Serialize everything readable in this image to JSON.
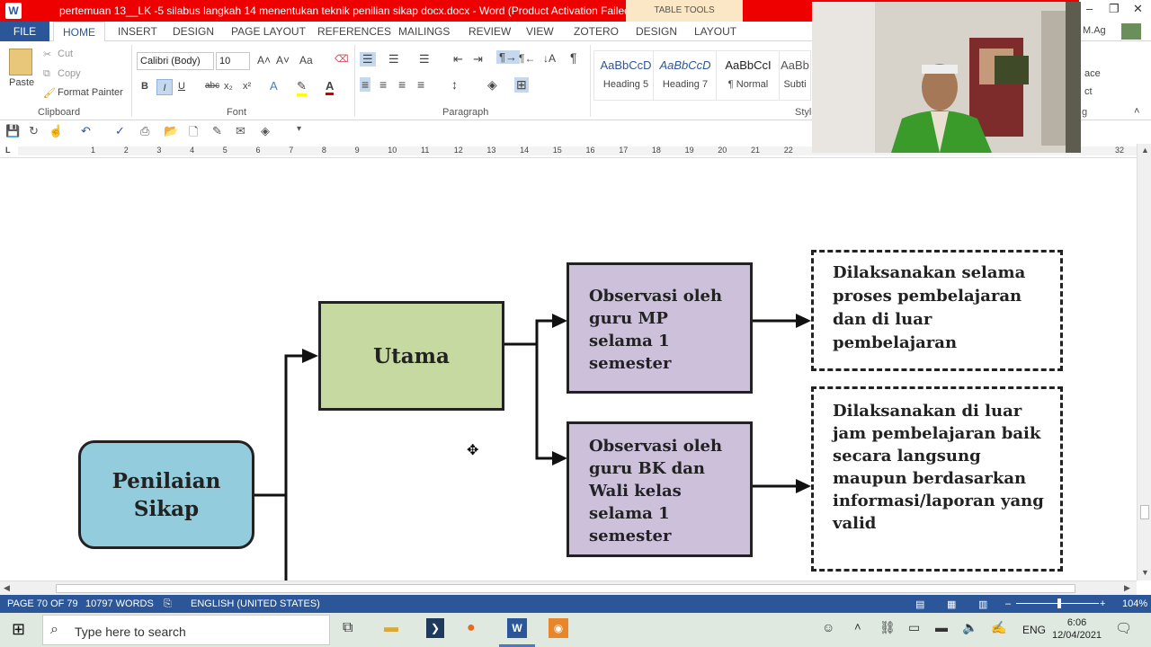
{
  "titlebar": {
    "title": "pertemuan 13__LK -5 silabus langkah 14 menentukan teknik penilian sikap docx.docx  -  Word (Product Activation Failed)",
    "table_tools": "TABLE TOOLS",
    "word_icon": "W"
  },
  "tabs": {
    "file": "FILE",
    "home": "HOME",
    "insert": "INSERT",
    "design": "DESIGN",
    "page_layout": "PAGE LAYOUT",
    "references": "REFERENCES",
    "mailings": "MAILINGS",
    "review": "REVIEW",
    "view": "VIEW",
    "zotero": "ZOTERO",
    "tt_design": "DESIGN",
    "tt_layout": "LAYOUT",
    "user": "M.Ag"
  },
  "ribbon": {
    "clipboard": {
      "paste": "Paste",
      "cut": "Cut",
      "copy": "Copy",
      "format_painter": "Format Painter",
      "label": "Clipboard"
    },
    "font": {
      "name": "Calibri (Body)",
      "size": "10",
      "label": "Font",
      "bold": "B",
      "italic": "I",
      "underline": "U",
      "strike": "abc",
      "sub": "x₂",
      "sup": "x²",
      "aa": "Aa"
    },
    "paragraph": {
      "label": "Paragraph"
    },
    "styles": {
      "label": "Styles",
      "items": [
        {
          "sample": "AaBbCcD",
          "name": "Heading 5"
        },
        {
          "sample": "AaBbCcD",
          "name": "Heading 7"
        },
        {
          "sample": "AaBbCcI",
          "name": "¶ Normal"
        },
        {
          "sample": "AaBb",
          "name": "Subti"
        }
      ]
    },
    "editing_fragments": {
      "replace": "ace",
      "select": "ct"
    },
    "editing_label": "g"
  },
  "ruler": {
    "numbers": [
      "1",
      "2",
      "3",
      "4",
      "5",
      "6",
      "7",
      "8",
      "9",
      "10",
      "11",
      "12",
      "13",
      "14",
      "15",
      "16",
      "17",
      "18",
      "19",
      "20",
      "21",
      "22",
      "32"
    ]
  },
  "diagram": {
    "root": "Penilaian Sikap",
    "main": "Utama",
    "obs1": "Observasi oleh guru MP selama 1 semester",
    "obs2": "Observasi oleh guru BK dan Wali kelas selama 1 semester",
    "note1": "Dilaksanakan selama proses pembelajaran dan di luar pembelajaran",
    "note2": "Dilaksanakan di luar jam pembelajaran baik secara langsung maupun berdasarkan informasi/laporan yang valid"
  },
  "status": {
    "page": "PAGE 70 OF 79",
    "words": "10797 WORDS",
    "language": "ENGLISH (UNITED STATES)",
    "zoom": "104%",
    "zoom_value": 104
  },
  "taskbar": {
    "search_placeholder": "Type here to search",
    "lang": "ENG",
    "time": "6:06",
    "date": "12/04/2021"
  },
  "colors": {
    "titlebar": "#ee0000",
    "word_blue": "#2b579a",
    "main_box": "#c6d9a0",
    "root_box": "#93cddd",
    "obs_box": "#ccc0da"
  }
}
